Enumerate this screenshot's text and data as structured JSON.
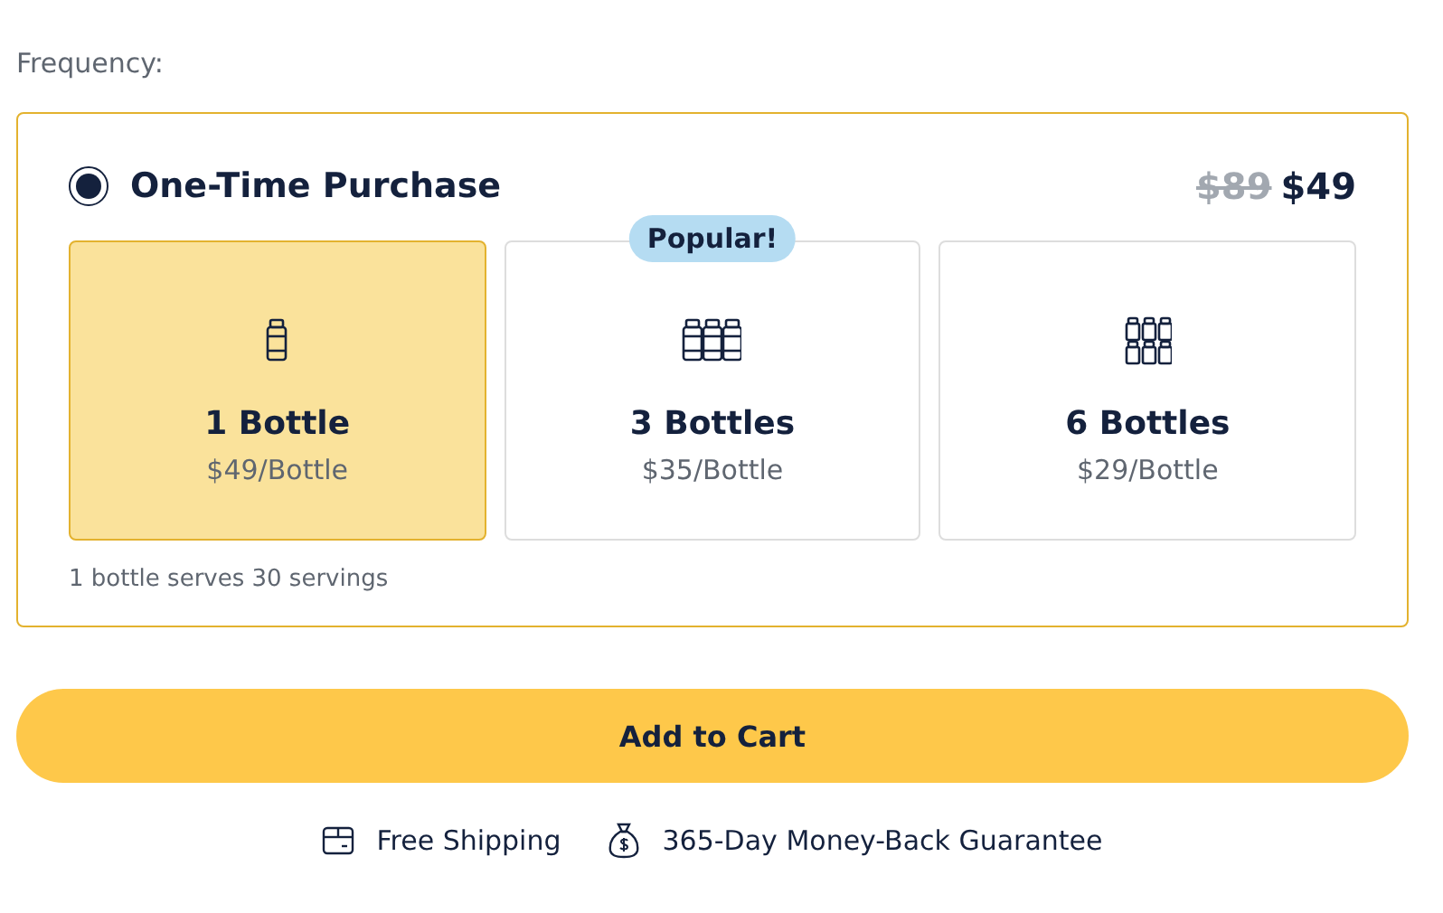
{
  "frequency_label": "Frequency:",
  "plan": {
    "selected": true,
    "title": "One-Time Purchase",
    "old_price": "$89",
    "price": "$49",
    "options": [
      {
        "kind": "single",
        "title": "1 Bottle",
        "price": "$49/Bottle",
        "selected": true
      },
      {
        "kind": "triple",
        "title": "3 Bottles",
        "price": "$35/Bottle",
        "selected": false,
        "badge": "Popular!"
      },
      {
        "kind": "six",
        "title": "6 Bottles",
        "price": "$29/Bottle",
        "selected": false
      }
    ],
    "note": "1 bottle serves 30 servings"
  },
  "add_to_cart": "Add to Cart",
  "perks": [
    {
      "kind": "box",
      "label": "Free Shipping"
    },
    {
      "kind": "money",
      "label": "365-Day Money-Back Guarantee"
    }
  ]
}
